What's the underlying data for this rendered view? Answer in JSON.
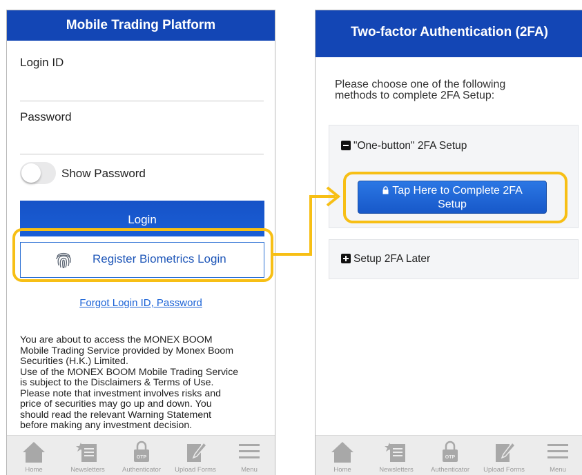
{
  "left_screen": {
    "title": "Mobile Trading Platform",
    "login_id_label": "Login ID",
    "login_id_value": "",
    "password_label": "Password",
    "password_value": "",
    "show_password_label": "Show Password",
    "show_password_on": false,
    "login_button": "Login",
    "biometrics_button": "Register Biometrics Login",
    "forgot_link": "Forgot Login ID, Password",
    "disclaimer_lines": [
      "You are about to access the MONEX BOOM",
      "Mobile Trading Service provided by Monex Boom",
      "Securities (H.K.) Limited.",
      "Use of the MONEX BOOM Mobile Trading Service",
      "is subject to the Disclaimers & Terms of Use.",
      "Please note that investment involves risks and",
      "price of securities may go up and down. You",
      "should read the relevant Warning Statement",
      "before making any investment decision."
    ]
  },
  "right_screen": {
    "title": "Two-factor Authentication (2FA)",
    "intro_line1": "Please choose one of the following",
    "intro_line2": "methods to complete 2FA Setup:",
    "one_button_section": "\"One-button\" 2FA Setup",
    "tap_button_line1": "Tap Here to Complete 2FA",
    "tap_button_line2": "Setup",
    "setup_later_section": "Setup 2FA Later"
  },
  "tab_bar": {
    "items": [
      {
        "label": "Home",
        "icon": "home-icon"
      },
      {
        "label": "Newsletters",
        "icon": "newsletter-icon"
      },
      {
        "label": "Authenticator",
        "icon": "otp-lock-icon",
        "badge": "OTP"
      },
      {
        "label": "Upload Forms",
        "icon": "edit-form-icon"
      },
      {
        "label": "Menu",
        "icon": "hamburger-icon"
      }
    ]
  },
  "colors": {
    "header_blue": "#1346b5",
    "button_blue": "#1b5fd6",
    "link_blue": "#1a62d6",
    "highlight_yellow": "#f7bf15",
    "tab_icon_gray": "#a8a8a8"
  }
}
